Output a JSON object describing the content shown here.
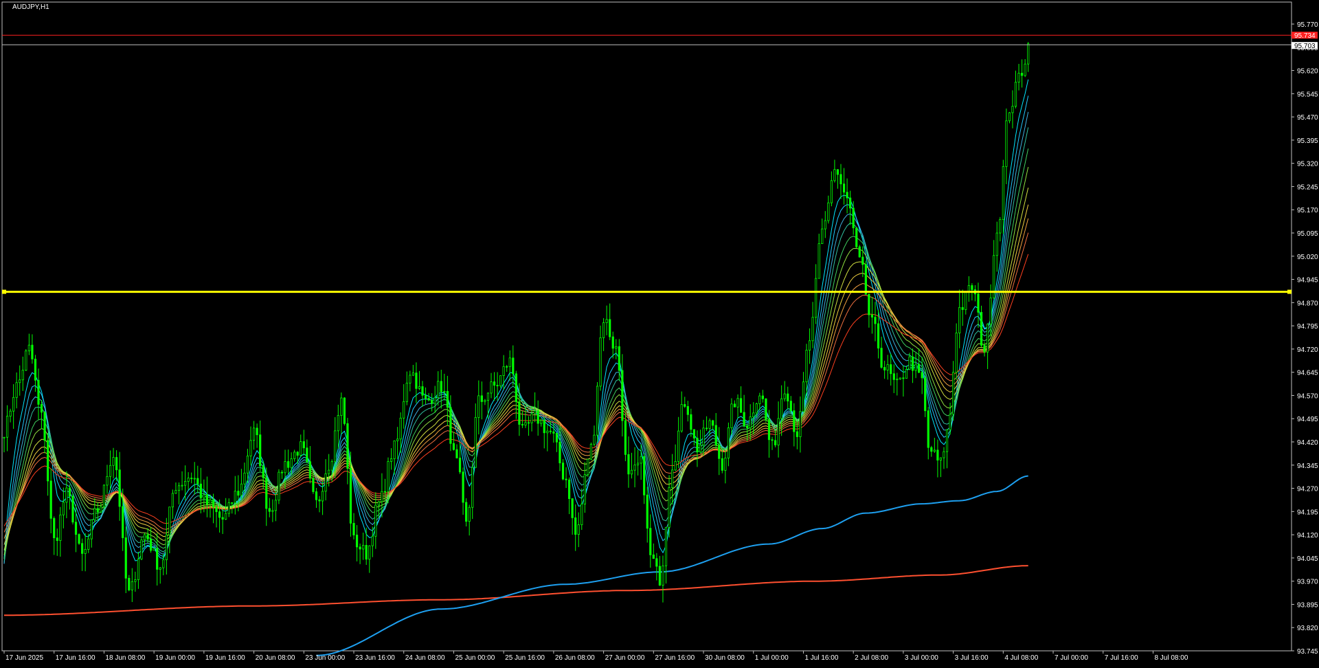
{
  "window": {
    "title": "AUDJPY,H1"
  },
  "colors": {
    "background": "#000000",
    "frame": "#c0c0c0",
    "text": "#ffffff",
    "candle": "#00ff00",
    "hline_yellow": "#ffff00",
    "hline_red": "#ff2020",
    "hline_white": "#c0c0c0",
    "ma_slow_blue": "#1ea0f0",
    "ma_slow_red": "#ff5030",
    "ribbon": [
      "#00e8ff",
      "#22c8ff",
      "#40b0e0",
      "#30c0a0",
      "#40d060",
      "#90e040",
      "#d0e040",
      "#f0d040",
      "#f0a040",
      "#f07040",
      "#ff4020"
    ]
  },
  "price_labels": {
    "current": "95.703",
    "red_line": "95.734"
  },
  "chart_data": {
    "type": "candlestick",
    "symbol": "AUDJPY",
    "timeframe": "H1",
    "ylim": [
      93.745,
      95.77
    ],
    "y_ticks": [
      "95.770",
      "95.695",
      "95.620",
      "95.545",
      "95.470",
      "95.395",
      "95.320",
      "95.245",
      "95.170",
      "95.095",
      "95.020",
      "94.945",
      "94.870",
      "94.795",
      "94.720",
      "94.645",
      "94.570",
      "94.495",
      "94.420",
      "94.345",
      "94.270",
      "94.195",
      "94.120",
      "94.045",
      "93.970",
      "93.895",
      "93.820",
      "93.745"
    ],
    "x_ticks": [
      "17 Jun 2025",
      "17 Jun 16:00",
      "18 Jun 08:00",
      "19 Jun 00:00",
      "19 Jun 16:00",
      "20 Jun 08:00",
      "23 Jun 00:00",
      "23 Jun 16:00",
      "24 Jun 08:00",
      "25 Jun 00:00",
      "25 Jun 16:00",
      "26 Jun 08:00",
      "27 Jun 00:00",
      "27 Jun 16:00",
      "30 Jun 08:00",
      "1 Jul 00:00",
      "1 Jul 16:00",
      "2 Jul 08:00",
      "3 Jul 00:00",
      "3 Jul 16:00",
      "4 Jul 08:00",
      "7 Jul 00:00",
      "7 Jul 16:00",
      "8 Jul 08:00"
    ],
    "horizontal_lines": [
      {
        "price": 94.905,
        "color": "#ffff00"
      },
      {
        "price": 95.734,
        "color": "#ff2020"
      },
      {
        "price": 95.703,
        "color": "#c0c0c0"
      }
    ],
    "series_anchors": [
      [
        0,
        94.46
      ],
      [
        4,
        94.6
      ],
      [
        8,
        94.72
      ],
      [
        12,
        94.5
      ],
      [
        16,
        94.1
      ],
      [
        20,
        94.25
      ],
      [
        25,
        94.05
      ],
      [
        30,
        94.2
      ],
      [
        35,
        94.38
      ],
      [
        40,
        93.93
      ],
      [
        45,
        94.12
      ],
      [
        50,
        94.02
      ],
      [
        55,
        94.28
      ],
      [
        60,
        94.31
      ],
      [
        65,
        94.22
      ],
      [
        70,
        94.17
      ],
      [
        75,
        94.26
      ],
      [
        80,
        94.45
      ],
      [
        85,
        94.2
      ],
      [
        90,
        94.35
      ],
      [
        95,
        94.4
      ],
      [
        100,
        94.22
      ],
      [
        104,
        94.35
      ],
      [
        108,
        94.55
      ],
      [
        112,
        94.1
      ],
      [
        116,
        94.06
      ],
      [
        120,
        94.22
      ],
      [
        125,
        94.4
      ],
      [
        130,
        94.65
      ],
      [
        135,
        94.55
      ],
      [
        140,
        94.6
      ],
      [
        145,
        94.35
      ],
      [
        148,
        94.15
      ],
      [
        152,
        94.55
      ],
      [
        157,
        94.6
      ],
      [
        162,
        94.68
      ],
      [
        166,
        94.45
      ],
      [
        170,
        94.5
      ],
      [
        175,
        94.45
      ],
      [
        180,
        94.3
      ],
      [
        183,
        94.12
      ],
      [
        188,
        94.4
      ],
      [
        192,
        94.82
      ],
      [
        196,
        94.72
      ],
      [
        200,
        94.3
      ],
      [
        204,
        94.35
      ],
      [
        207,
        94.05
      ],
      [
        210,
        93.98
      ],
      [
        214,
        94.35
      ],
      [
        218,
        94.55
      ],
      [
        222,
        94.4
      ],
      [
        226,
        94.48
      ],
      [
        230,
        94.35
      ],
      [
        234,
        94.55
      ],
      [
        238,
        94.48
      ],
      [
        242,
        94.58
      ],
      [
        246,
        94.4
      ],
      [
        250,
        94.6
      ],
      [
        254,
        94.45
      ],
      [
        258,
        94.75
      ],
      [
        262,
        95.1
      ],
      [
        266,
        95.3
      ],
      [
        270,
        95.2
      ],
      [
        274,
        95.0
      ],
      [
        278,
        94.8
      ],
      [
        282,
        94.66
      ],
      [
        286,
        94.6
      ],
      [
        290,
        94.68
      ],
      [
        294,
        94.62
      ],
      [
        296,
        94.4
      ],
      [
        300,
        94.35
      ],
      [
        302,
        94.45
      ],
      [
        306,
        94.85
      ],
      [
        310,
        94.92
      ],
      [
        314,
        94.72
      ],
      [
        318,
        95.1
      ],
      [
        322,
        95.5
      ],
      [
        326,
        95.62
      ],
      [
        328,
        95.7
      ]
    ],
    "ma_slow_blue_anchors": [
      [
        100,
        93.73
      ],
      [
        140,
        93.88
      ],
      [
        180,
        93.96
      ],
      [
        210,
        94.0
      ],
      [
        245,
        94.09
      ],
      [
        262,
        94.14
      ],
      [
        276,
        94.19
      ],
      [
        294,
        94.22
      ],
      [
        306,
        94.23
      ],
      [
        318,
        94.26
      ],
      [
        328,
        94.31
      ]
    ],
    "ma_slow_red_anchors": [
      [
        0,
        93.86
      ],
      [
        80,
        93.89
      ],
      [
        140,
        93.91
      ],
      [
        200,
        93.94
      ],
      [
        260,
        93.97
      ],
      [
        300,
        93.99
      ],
      [
        328,
        94.02
      ]
    ],
    "last_bar_index": 328,
    "visible_bars": 413
  }
}
